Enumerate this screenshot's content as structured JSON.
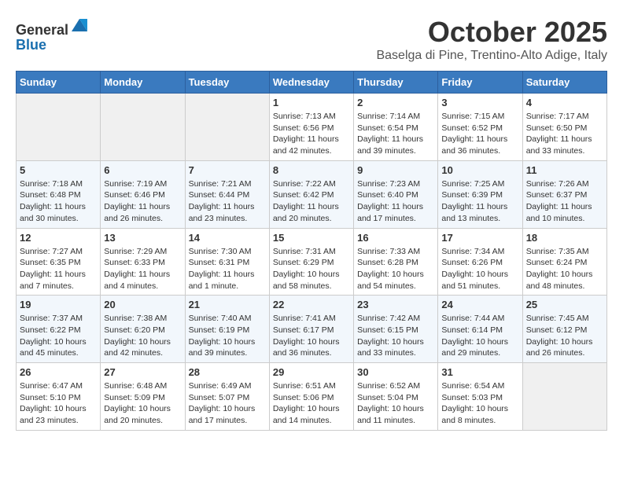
{
  "header": {
    "logo_line1": "General",
    "logo_line2": "Blue",
    "month": "October 2025",
    "location": "Baselga di Pine, Trentino-Alto Adige, Italy"
  },
  "weekdays": [
    "Sunday",
    "Monday",
    "Tuesday",
    "Wednesday",
    "Thursday",
    "Friday",
    "Saturday"
  ],
  "weeks": [
    [
      {
        "day": "",
        "info": ""
      },
      {
        "day": "",
        "info": ""
      },
      {
        "day": "",
        "info": ""
      },
      {
        "day": "1",
        "info": "Sunrise: 7:13 AM\nSunset: 6:56 PM\nDaylight: 11 hours and 42 minutes."
      },
      {
        "day": "2",
        "info": "Sunrise: 7:14 AM\nSunset: 6:54 PM\nDaylight: 11 hours and 39 minutes."
      },
      {
        "day": "3",
        "info": "Sunrise: 7:15 AM\nSunset: 6:52 PM\nDaylight: 11 hours and 36 minutes."
      },
      {
        "day": "4",
        "info": "Sunrise: 7:17 AM\nSunset: 6:50 PM\nDaylight: 11 hours and 33 minutes."
      }
    ],
    [
      {
        "day": "5",
        "info": "Sunrise: 7:18 AM\nSunset: 6:48 PM\nDaylight: 11 hours and 30 minutes."
      },
      {
        "day": "6",
        "info": "Sunrise: 7:19 AM\nSunset: 6:46 PM\nDaylight: 11 hours and 26 minutes."
      },
      {
        "day": "7",
        "info": "Sunrise: 7:21 AM\nSunset: 6:44 PM\nDaylight: 11 hours and 23 minutes."
      },
      {
        "day": "8",
        "info": "Sunrise: 7:22 AM\nSunset: 6:42 PM\nDaylight: 11 hours and 20 minutes."
      },
      {
        "day": "9",
        "info": "Sunrise: 7:23 AM\nSunset: 6:40 PM\nDaylight: 11 hours and 17 minutes."
      },
      {
        "day": "10",
        "info": "Sunrise: 7:25 AM\nSunset: 6:39 PM\nDaylight: 11 hours and 13 minutes."
      },
      {
        "day": "11",
        "info": "Sunrise: 7:26 AM\nSunset: 6:37 PM\nDaylight: 11 hours and 10 minutes."
      }
    ],
    [
      {
        "day": "12",
        "info": "Sunrise: 7:27 AM\nSunset: 6:35 PM\nDaylight: 11 hours and 7 minutes."
      },
      {
        "day": "13",
        "info": "Sunrise: 7:29 AM\nSunset: 6:33 PM\nDaylight: 11 hours and 4 minutes."
      },
      {
        "day": "14",
        "info": "Sunrise: 7:30 AM\nSunset: 6:31 PM\nDaylight: 11 hours and 1 minute."
      },
      {
        "day": "15",
        "info": "Sunrise: 7:31 AM\nSunset: 6:29 PM\nDaylight: 10 hours and 58 minutes."
      },
      {
        "day": "16",
        "info": "Sunrise: 7:33 AM\nSunset: 6:28 PM\nDaylight: 10 hours and 54 minutes."
      },
      {
        "day": "17",
        "info": "Sunrise: 7:34 AM\nSunset: 6:26 PM\nDaylight: 10 hours and 51 minutes."
      },
      {
        "day": "18",
        "info": "Sunrise: 7:35 AM\nSunset: 6:24 PM\nDaylight: 10 hours and 48 minutes."
      }
    ],
    [
      {
        "day": "19",
        "info": "Sunrise: 7:37 AM\nSunset: 6:22 PM\nDaylight: 10 hours and 45 minutes."
      },
      {
        "day": "20",
        "info": "Sunrise: 7:38 AM\nSunset: 6:20 PM\nDaylight: 10 hours and 42 minutes."
      },
      {
        "day": "21",
        "info": "Sunrise: 7:40 AM\nSunset: 6:19 PM\nDaylight: 10 hours and 39 minutes."
      },
      {
        "day": "22",
        "info": "Sunrise: 7:41 AM\nSunset: 6:17 PM\nDaylight: 10 hours and 36 minutes."
      },
      {
        "day": "23",
        "info": "Sunrise: 7:42 AM\nSunset: 6:15 PM\nDaylight: 10 hours and 33 minutes."
      },
      {
        "day": "24",
        "info": "Sunrise: 7:44 AM\nSunset: 6:14 PM\nDaylight: 10 hours and 29 minutes."
      },
      {
        "day": "25",
        "info": "Sunrise: 7:45 AM\nSunset: 6:12 PM\nDaylight: 10 hours and 26 minutes."
      }
    ],
    [
      {
        "day": "26",
        "info": "Sunrise: 6:47 AM\nSunset: 5:10 PM\nDaylight: 10 hours and 23 minutes."
      },
      {
        "day": "27",
        "info": "Sunrise: 6:48 AM\nSunset: 5:09 PM\nDaylight: 10 hours and 20 minutes."
      },
      {
        "day": "28",
        "info": "Sunrise: 6:49 AM\nSunset: 5:07 PM\nDaylight: 10 hours and 17 minutes."
      },
      {
        "day": "29",
        "info": "Sunrise: 6:51 AM\nSunset: 5:06 PM\nDaylight: 10 hours and 14 minutes."
      },
      {
        "day": "30",
        "info": "Sunrise: 6:52 AM\nSunset: 5:04 PM\nDaylight: 10 hours and 11 minutes."
      },
      {
        "day": "31",
        "info": "Sunrise: 6:54 AM\nSunset: 5:03 PM\nDaylight: 10 hours and 8 minutes."
      },
      {
        "day": "",
        "info": ""
      }
    ]
  ]
}
